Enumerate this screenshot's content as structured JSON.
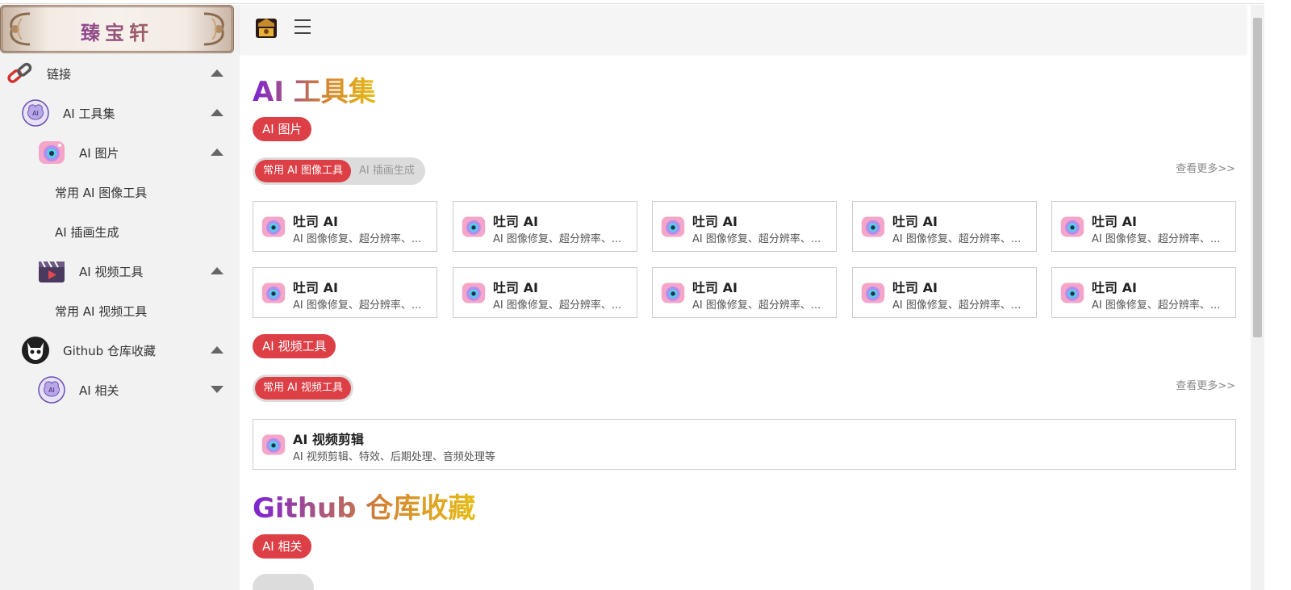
{
  "brand": {
    "name": "臻宝轩"
  },
  "sidebar": {
    "items": [
      {
        "label": "链接",
        "icon": "chain-icon",
        "arrow": "up"
      },
      {
        "label": "AI 工具集",
        "icon": "ai-brain-icon",
        "arrow": "up"
      },
      {
        "label": "AI 图片",
        "icon": "camera-icon",
        "arrow": "up"
      },
      {
        "label": "常用 AI 图像工具",
        "icon": "",
        "arrow": ""
      },
      {
        "label": "AI 插画生成",
        "icon": "",
        "arrow": ""
      },
      {
        "label": "AI 视频工具",
        "icon": "video-clapper-icon",
        "arrow": "up"
      },
      {
        "label": "常用 AI 视频工具",
        "icon": "",
        "arrow": ""
      },
      {
        "label": "Github 仓库收藏",
        "icon": "github-cat-icon",
        "arrow": "up"
      },
      {
        "label": "AI 相关",
        "icon": "ai-brain-icon",
        "arrow": "down"
      }
    ]
  },
  "main": {
    "section1": {
      "title": "AI 工具集",
      "group1": {
        "pill": "AI 图片",
        "tabs": [
          "常用 AI 图像工具",
          "AI 插画生成"
        ],
        "more": "查看更多>>",
        "card_title": "吐司 AI",
        "card_desc": "AI 图像修复、超分辨率、..."
      },
      "group2": {
        "pill": "AI 视频工具",
        "tabs": [
          "常用 AI 视频工具"
        ],
        "more": "查看更多>>",
        "card_title": "AI 视频剪辑",
        "card_desc": "AI 视频剪辑、特效、后期处理、音频处理等"
      }
    },
    "section2": {
      "title": "Github 仓库收藏",
      "pill": "AI 相关"
    }
  }
}
